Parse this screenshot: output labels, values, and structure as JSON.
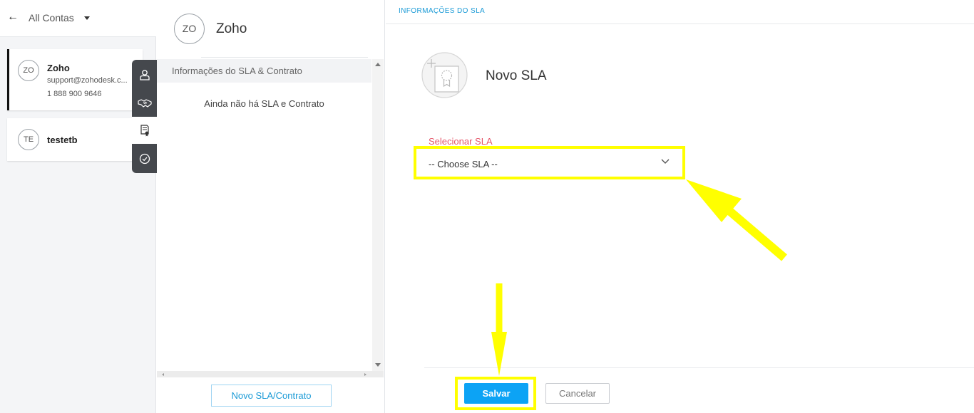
{
  "left_panel": {
    "header_label": "All Contas",
    "accounts": [
      {
        "initials": "ZO",
        "name": "Zoho",
        "email": "support@zohodesk.c...",
        "phone": "1 888 900 9646",
        "selected": true
      },
      {
        "initials": "TE",
        "name": "testetb",
        "selected": false
      }
    ],
    "strip_icons": [
      "contact-icon",
      "handshake-icon",
      "contract-icon",
      "check-circle-icon"
    ]
  },
  "middle_panel": {
    "initials": "ZO",
    "account_name": "Zoho",
    "section_title": "Informações do SLA & Contrato",
    "empty_message": "Ainda não há SLA e Contrato",
    "new_button": "Novo SLA/Contrato"
  },
  "right_panel": {
    "header_title": "INFORMAÇÕES DO SLA",
    "form_title": "Novo SLA",
    "select_label": "Selecionar SLA",
    "select_value": "-- Choose SLA --",
    "save_label": "Salvar",
    "cancel_label": "Cancelar"
  },
  "colors": {
    "accent_blue": "#0ca3f5",
    "link_blue": "#1a9ad6",
    "label_red": "#e5566a",
    "annotation_yellow": "#ffff00",
    "strip_dark": "#45484d"
  }
}
